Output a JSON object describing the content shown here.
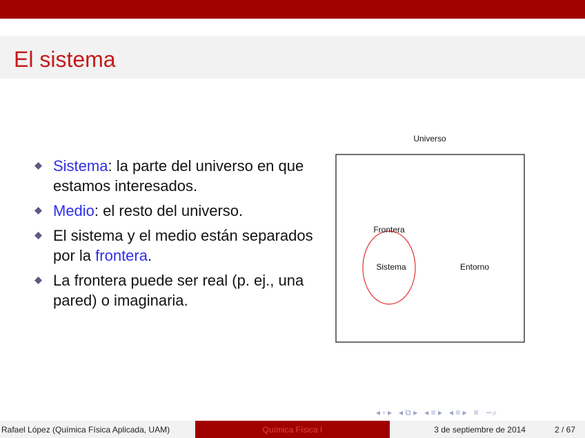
{
  "slide": {
    "title": "El sistema",
    "bullets": [
      {
        "term": "Sistema",
        "rest": ": la parte del universo en que estamos interesados."
      },
      {
        "term": "Medio",
        "rest": ": el resto del universo."
      },
      {
        "pre": "El sistema y el medio están separados por la ",
        "term": "frontera",
        "post": "."
      },
      {
        "text": "La frontera puede ser real (p. ej., una pared) o imaginaria."
      }
    ]
  },
  "diagram": {
    "universe_label": "Universo",
    "boundary_label": "Frontera",
    "system_label": "Sistema",
    "surroundings_label": "Entorno"
  },
  "footer": {
    "author": "Rafael López (Química Física Aplicada, UAM)",
    "course": "Química Física I",
    "date": "3 de septiembre de 2014",
    "page": "2 / 67"
  },
  "nav_icons": [
    "nav-first-icon",
    "nav-prev-frame-icon",
    "nav-prev-section-icon",
    "nav-next-section-icon",
    "nav-align-icon",
    "nav-search-icon"
  ],
  "colors": {
    "accent": "#a00000",
    "title": "#c41a1a",
    "highlight": "#2f2fe6",
    "ellipse": "#e03030"
  }
}
